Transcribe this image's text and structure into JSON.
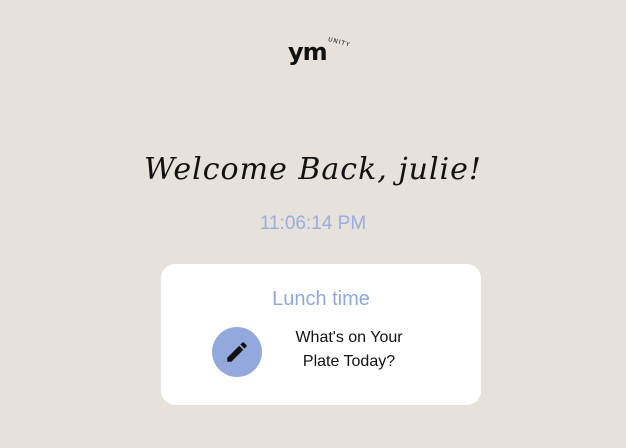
{
  "brand": {
    "logo_text": "ym",
    "logo_subtext": "UNITY"
  },
  "greeting": "Welcome Back, julie!",
  "clock": "11:06:14 PM",
  "card": {
    "title": "Lunch time",
    "prompt_line1": "What's on Your",
    "prompt_line2": "Plate Today?",
    "edit_icon": "pencil-icon"
  },
  "colors": {
    "background": "#e6e1da",
    "accent": "#93a9de",
    "card": "#ffffff"
  }
}
